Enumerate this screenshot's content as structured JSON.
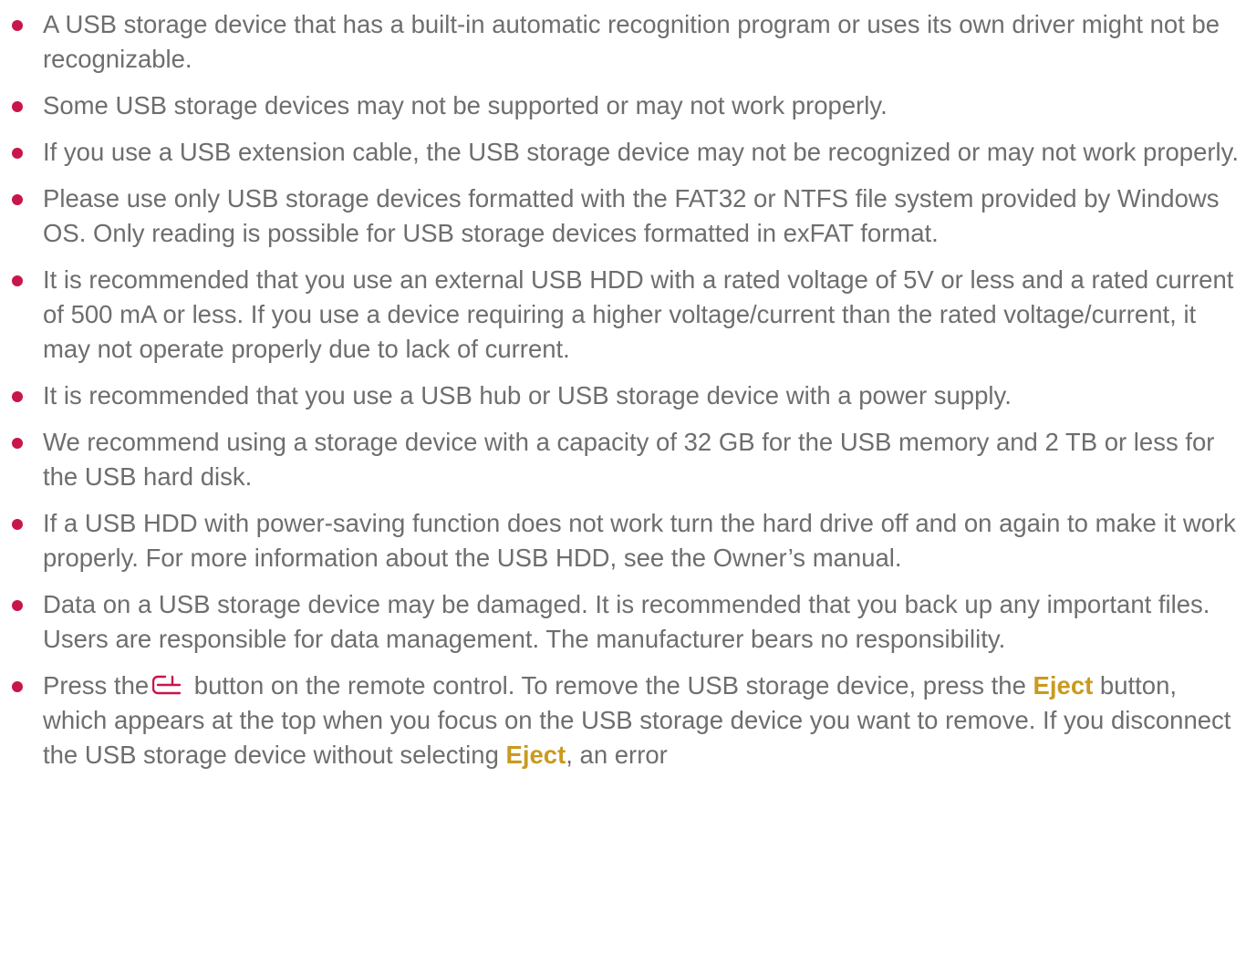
{
  "notes": [
    "A USB storage device that has a built-in automatic recognition program or uses its own driver might not be recognizable.",
    "Some USB storage devices may not be supported or may not work properly.",
    "If you use a USB extension cable, the USB storage device may not be recognized or may not work properly.",
    "Please use only USB storage devices formatted with the FAT32 or NTFS file system provided by Windows OS. Only reading is possible for USB storage devices formatted in exFAT format.",
    "It is recommended that you use an external USB HDD with a rated voltage of 5V or less and a rated current of 500 mA or less. If you use a device requiring a higher voltage/current than the rated voltage/current, it may not operate properly due to lack of current.",
    "It is recommended that you use a USB hub or USB storage device with a power supply.",
    "We recommend using a storage device with a capacity of 32 GB for the USB memory and 2 TB or less for the USB hard disk.",
    "If a USB HDD with power-saving function does not work turn the hard drive off and on again to make it work properly. For more information about the USB HDD, see the Owner’s manual.",
    "Data on a USB storage device may be damaged. It is recommended that you back up any important files. Users are responsible for data management. The manufacturer bears no responsibility."
  ],
  "last_note": {
    "part1": "Press the",
    "icon": "input-source-icon",
    "part2": " button on the remote control. To remove the USB storage device, press the ",
    "eject_1": "Eject",
    "part3": " button, which appears at the top when you focus on the USB storage device you want to remove. If you disconnect the USB storage device without selecting ",
    "eject_2": "Eject",
    "part4": ", an error"
  },
  "colors": {
    "text": "#6e6e6e",
    "bullet": "#c8164a",
    "highlight": "#c99a1e",
    "icon": "#c8164a"
  }
}
